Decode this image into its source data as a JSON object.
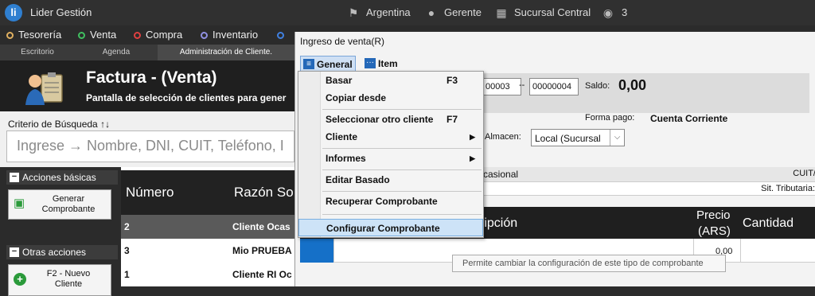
{
  "topbar": {
    "logo": "li",
    "app_title": "Lider Gestión",
    "country": "Argentina",
    "user": "Gerente",
    "branch": "Sucursal Central",
    "location_count": "3"
  },
  "menubar": {
    "items": [
      {
        "label": "Tesorería",
        "color": "#e0b060"
      },
      {
        "label": "Venta",
        "color": "#40c060"
      },
      {
        "label": "Compra",
        "color": "#e04040"
      },
      {
        "label": "Inventario",
        "color": "#9090e0"
      }
    ]
  },
  "tabs": [
    "Escritorio",
    "Agenda",
    "Administración de Cliente."
  ],
  "header": {
    "title": "Factura - (Venta)",
    "subtitle": "Pantalla de selección de clientes para gener"
  },
  "search": {
    "label": "Criterio de Búsqueda ↑↓",
    "placeholder": "Ingrese → Nombre, DNI, CUIT, Teléfono, I"
  },
  "actions": {
    "basic_label": "Acciones básicas",
    "generate_label_1": "Generar",
    "generate_label_2": "Comprobante",
    "other_label": "Otras acciones",
    "new_client_label_1": "F2 - Nuevo",
    "new_client_label_2": "Cliente"
  },
  "grid": {
    "columns": [
      "Número",
      "Razón So"
    ],
    "rows": [
      {
        "num": "2",
        "name": "Cliente Ocas"
      },
      {
        "num": "3",
        "name": "Mio PRUEBA"
      },
      {
        "num": "1",
        "name": "Cliente RI Oc"
      }
    ]
  },
  "dialog": {
    "title": "Ingreso de venta(R)",
    "menu_general": "General",
    "menu_item": "Item",
    "num_a": "00003",
    "num_sep": "--",
    "num_b": "00000004",
    "saldo_label": "Saldo:",
    "saldo_value": "0,00",
    "forma_pago_label": "Forma pago:",
    "forma_pago_value": "Cuenta Corriente",
    "almacen_label": "Almacen:",
    "almacen_value": "Local (Sucursal",
    "ocasional": "casional",
    "cuit_label": "CUIT/",
    "sit_trib_label": "Sit. Tributaria:",
    "col_descripcion": "ripción",
    "col_precio_1": "Precio",
    "col_precio_2": "(ARS)",
    "col_cantidad": "Cantidad",
    "precio_value": "0,00"
  },
  "dropdown": {
    "items": [
      {
        "label": "Basar",
        "key": "F3"
      },
      {
        "label": "Copiar desde",
        "key": ""
      },
      {
        "label": "Seleccionar otro cliente",
        "key": "F7"
      },
      {
        "label": "Cliente",
        "key": ""
      },
      {
        "label": "Informes",
        "key": ""
      },
      {
        "label": "Editar Basado",
        "key": ""
      },
      {
        "label": "Recuperar Comprobante",
        "key": ""
      },
      {
        "label": "Configurar Comprobante",
        "key": ""
      }
    ]
  },
  "tooltip": "Permite cambiar la configuración de este tipo de comprobante"
}
